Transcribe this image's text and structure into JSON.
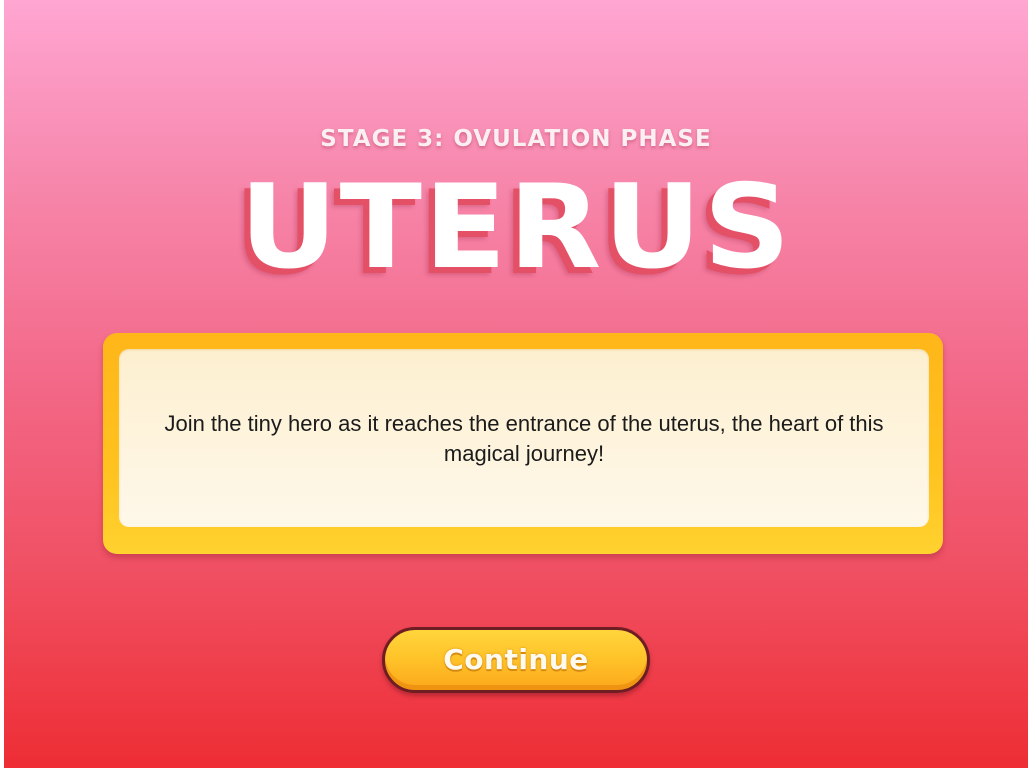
{
  "screen": {
    "stage_label": "STAGE 3: OVULATION PHASE",
    "title": "UTERUS"
  },
  "card": {
    "description": "Join the tiny hero as it reaches the entrance of the uterus, the heart of this magical journey!"
  },
  "actions": {
    "continue_label": "Continue"
  },
  "colors": {
    "background_top": "#ffa6d2",
    "background_bottom": "#ee2d34",
    "title_shadow": "#e45066",
    "card_frame": "#ffc21f",
    "card_fill": "#fef8ea",
    "button_fill": "#ffc42a",
    "button_border": "#6e1d22"
  }
}
